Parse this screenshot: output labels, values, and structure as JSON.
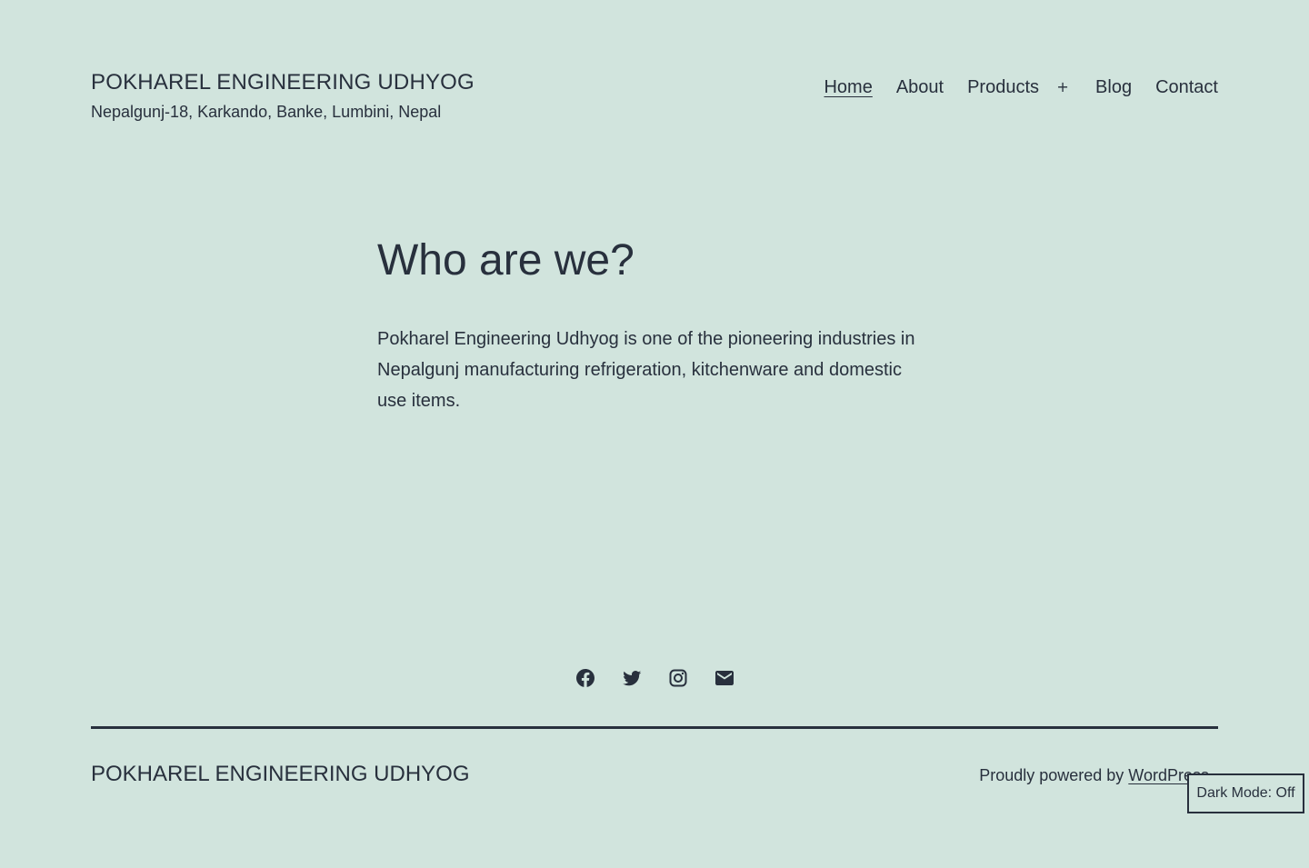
{
  "header": {
    "site_title": "POKHAREL ENGINEERING UDHYOG",
    "site_description": "Nepalgunj-18, Karkando, Banke, Lumbini, Nepal"
  },
  "nav": {
    "items": [
      {
        "label": "Home",
        "current": true
      },
      {
        "label": "About"
      },
      {
        "label": "Products"
      },
      {
        "label": "Blog"
      },
      {
        "label": "Contact"
      }
    ],
    "submenu_toggle": "+"
  },
  "main": {
    "title": "Who are we?",
    "text": "Pokharel Engineering Udhyog is one of the pioneering industries in Nepalgunj manufacturing refrigeration, kitchenware and domestic use items."
  },
  "social": {
    "icons": [
      "facebook-icon",
      "twitter-icon",
      "instagram-icon",
      "mail-icon"
    ]
  },
  "footer": {
    "site_title": "POKHAREL ENGINEERING UDHYOG",
    "powered_prefix": "Proudly powered by ",
    "powered_link": "WordPress.",
    "dark_mode_label": "Dark Mode: Off"
  },
  "colors": {
    "background": "#d1e4dd",
    "text": "#28303d"
  }
}
